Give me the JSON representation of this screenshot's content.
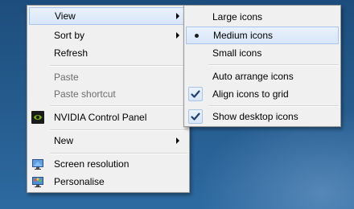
{
  "context_menu": {
    "items": [
      {
        "label": "View"
      },
      {
        "label": "Sort by"
      },
      {
        "label": "Refresh"
      },
      {
        "label": "Paste"
      },
      {
        "label": "Paste shortcut"
      },
      {
        "label": "NVIDIA Control Panel"
      },
      {
        "label": "New"
      },
      {
        "label": "Screen resolution"
      },
      {
        "label": "Personalise"
      }
    ]
  },
  "view_submenu": {
    "items": [
      {
        "label": "Large icons"
      },
      {
        "label": "Medium icons"
      },
      {
        "label": "Small icons"
      },
      {
        "label": "Auto arrange icons"
      },
      {
        "label": "Align icons to grid"
      },
      {
        "label": "Show desktop icons"
      }
    ]
  },
  "colors": {
    "desktop_background": "#245a8c",
    "menu_background": "#f0f0f0",
    "highlight_fill": "#dce8f8",
    "highlight_border": "#a8c6ec",
    "disabled_text": "#6d6d6d",
    "nvidia_green": "#76b900"
  },
  "icons": {
    "nvidia": "nvidia-logo-icon",
    "screen_resolution": "monitor-icon",
    "personalise": "personalise-monitor-icon",
    "check": "checkmark-icon",
    "radio": "radio-dot-icon",
    "submenu": "chevron-right-icon"
  }
}
